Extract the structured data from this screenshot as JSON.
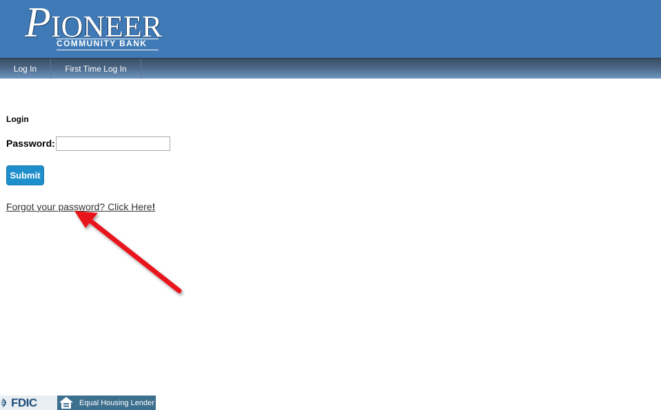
{
  "header": {
    "logo_main_first": "P",
    "logo_main_rest": "IONEER",
    "logo_sub": "COMMUNITY BANK"
  },
  "nav": {
    "items": [
      {
        "label": "Log In"
      },
      {
        "label": "First Time Log In"
      }
    ]
  },
  "login": {
    "title": "Login",
    "password_label": "Password:",
    "password_value": "",
    "submit_label": "Submit",
    "forgot_text": "Forgot your password? Click Here",
    "forgot_bang": "!"
  },
  "footer": {
    "fdic_label": "FDIC",
    "ehl_label": "Equal Housing Lender"
  },
  "colors": {
    "header_bg": "#3f7ab6",
    "submit_bg": "#1e8fcc",
    "arrow": "#e8151b"
  },
  "icons": {
    "arrow": "red-arrow-annotation-icon",
    "house": "equal-housing-house-icon"
  }
}
